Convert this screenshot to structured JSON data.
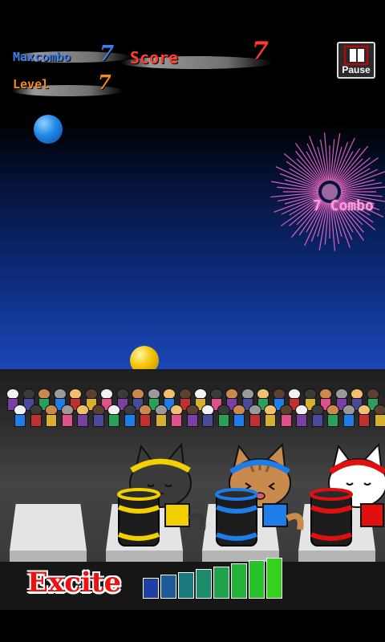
{
  "hud": {
    "maxcombo_label": "Maxcombo",
    "maxcombo_value": "7",
    "score_label": "Score",
    "score_value": "7",
    "level_label": "Level",
    "level_value": "7",
    "pause_label": "Pause"
  },
  "combo": {
    "text": "7 Combo"
  },
  "excite": {
    "label": "Excite",
    "meter_level": 1.0,
    "meter_colors": [
      "#1f3fa5",
      "#1d5a9a",
      "#1b7a7e",
      "#1c8c6a",
      "#21a24c",
      "#23b33a",
      "#28c22a",
      "#34d11f"
    ]
  },
  "colors": {
    "maxcombo_label": "#3f7ee8",
    "maxcombo_value": "#3f7ee8",
    "score_label": "#ff3b2a",
    "score_value": "#ff3b2a",
    "level_label": "#f08a1e",
    "level_value": "#f08a1e",
    "ball_blue": "#1e88e5",
    "ball_yellow": "#f2c200",
    "firework": "#ff6fd0"
  },
  "performers": [
    {
      "name": "black-cat-drummer",
      "rope_color": "#f2d000",
      "fur": "#3a3a3a"
    },
    {
      "name": "tabby-cat-drummer",
      "rope_color": "#1e7de8",
      "fur": "#c98a4e"
    },
    {
      "name": "white-cat-drummer",
      "rope_color": "#e01010",
      "fur": "#ffffff"
    }
  ]
}
